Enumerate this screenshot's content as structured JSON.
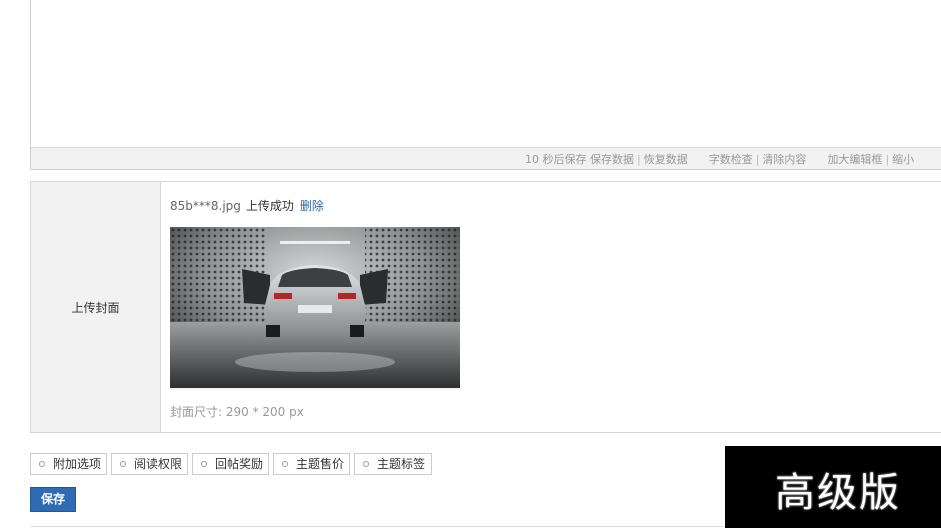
{
  "editor": {
    "status_bar": {
      "autosave": "10 秒后保存",
      "save_data": "保存数据",
      "restore_data": "恢复数据",
      "word_check": "字数检查",
      "clear_content": "清除内容",
      "enlarge_editor": "加大编辑框",
      "shrink": "缩小"
    }
  },
  "cover": {
    "label": "上传封面",
    "filename": "85b***8.jpg",
    "status": "上传成功",
    "delete": "删除",
    "size_note": "封面尺寸: 290 * 200 px"
  },
  "options": [
    {
      "label": "附加选项"
    },
    {
      "label": "阅读权限"
    },
    {
      "label": "回帖奖励"
    },
    {
      "label": "主题售价"
    },
    {
      "label": "主题标签"
    }
  ],
  "save_button": "保存",
  "watermark": "高级版",
  "colors": {
    "accent": "#2f6bb5",
    "link": "#336699",
    "panel_bg": "#f2f2f2"
  }
}
